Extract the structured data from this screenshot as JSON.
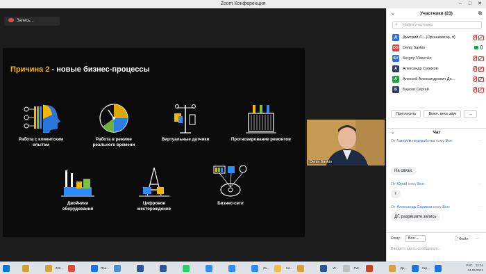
{
  "window": {
    "title": "Zoom Конференция"
  },
  "recording": {
    "label": "Запись..."
  },
  "slide": {
    "title_highlight": "Причина 2",
    "title_rest": " - новые бизнес-процессы",
    "tiles": [
      {
        "line1": "Работа с клиентским",
        "line2": "опытом",
        "icon": "customer-head-icon"
      },
      {
        "line1": "Работа в режиме",
        "line2": "реального времени",
        "icon": "clock-dial-icon"
      },
      {
        "line1": "Виртуальные датчики",
        "line2": "",
        "icon": "sensor-pole-icon"
      },
      {
        "line1": "Прогнозирование ремонтов",
        "line2": "",
        "icon": "transformer-icon"
      },
      {
        "line1": "Двойники",
        "line2": "оборудования",
        "icon": "factory-twin-icon"
      },
      {
        "line1": "Цифровое",
        "line2": "месторождение",
        "icon": "oil-rig-icon"
      },
      {
        "line1": "Бизнес-сети",
        "line2": "",
        "icon": "business-network-icon"
      }
    ]
  },
  "video": {
    "name": "Denis Savkin"
  },
  "participants": {
    "header": "Участники (23)",
    "search_placeholder": "Найти участника",
    "list": [
      {
        "initial": "Д",
        "name": "Дмитрий Л... (Организатор, я)",
        "color": "#2d6fe0",
        "mic": "off",
        "cam": "off"
      },
      {
        "initial": "DS",
        "name": "Denis Savkin",
        "color": "#e0403a",
        "mic": "on",
        "cam": "on"
      },
      {
        "initial": "SV",
        "name": "Sergey Vlasenko",
        "color": "#2d6fe0",
        "mic": "off",
        "cam": "off"
      },
      {
        "initial": "А",
        "name": "Александр Сериков",
        "color": "#2c3e66",
        "mic": "off",
        "cam": "off"
      },
      {
        "initial": "А",
        "name": "Алексей Александрович Да...",
        "color": "#1aaa3c",
        "mic": "off",
        "cam": "off"
      },
      {
        "initial": "Б",
        "name": "Баусов Сергей",
        "color": "#2c3e66",
        "mic": "off",
        "cam": "off"
      }
    ],
    "invite_label": "Пригласить",
    "mute_all_label": "Выкл. весь звук",
    "more_label": "..."
  },
  "chat": {
    "header": "Чат",
    "messages": [
      {
        "from_prefix": "От ",
        "from": "Газпром переработка",
        "to_text": " кому ",
        "to": "Все:",
        "text": "На связи."
      },
      {
        "from_prefix": "От ",
        "from": "Юрий",
        "to_text": " кому ",
        "to": "Все:",
        "text": "+"
      },
      {
        "from_prefix": "От ",
        "from": "Александр Сериков",
        "to_text": " кому ",
        "to": "Все:",
        "text": "ДГ, разрешите запись"
      }
    ],
    "to_label": "Кому:",
    "to_value": "Все",
    "file_label": "Файл",
    "more_label": "...",
    "input_placeholder": "Введите здесь сообщение..."
  },
  "taskbar": {
    "items": [
      {
        "label": "",
        "color": "#d0a030"
      },
      {
        "label": "202...",
        "color": "#d9a13b"
      },
      {
        "label": "",
        "color": "#e24a33"
      },
      {
        "label": "Про...",
        "color": "#1a73e8"
      },
      {
        "label": "",
        "color": "#4a90d9"
      },
      {
        "label": "",
        "color": "#2b579a"
      },
      {
        "label": "",
        "color": "#2b579a"
      },
      {
        "label": "",
        "color": "#25d366"
      },
      {
        "label": "",
        "color": "#2d8cff"
      },
      {
        "label": "",
        "color": "#2d8cff"
      },
      {
        "label": "Zo...",
        "color": "#2d8cff"
      },
      {
        "label": "Int...",
        "color": "#f0c040"
      },
      {
        "label": "",
        "color": "#d9a13b"
      },
      {
        "label": "W...",
        "color": "#2b579a"
      },
      {
        "label": "FW...",
        "color": "#c0c0c0"
      },
      {
        "label": "",
        "color": "#d04423"
      },
      {
        "label": "Де...",
        "color": "#d9a13b"
      },
      {
        "label": "Скр...",
        "color": "#1a73e8"
      },
      {
        "label": "",
        "color": "#1a73e8"
      }
    ],
    "lang": "РУС",
    "time": "12:01",
    "date": "24.05.2021"
  },
  "colors": {
    "accent": "#f5b800",
    "brand": "#2d8cff",
    "alert": "#e0322a"
  }
}
